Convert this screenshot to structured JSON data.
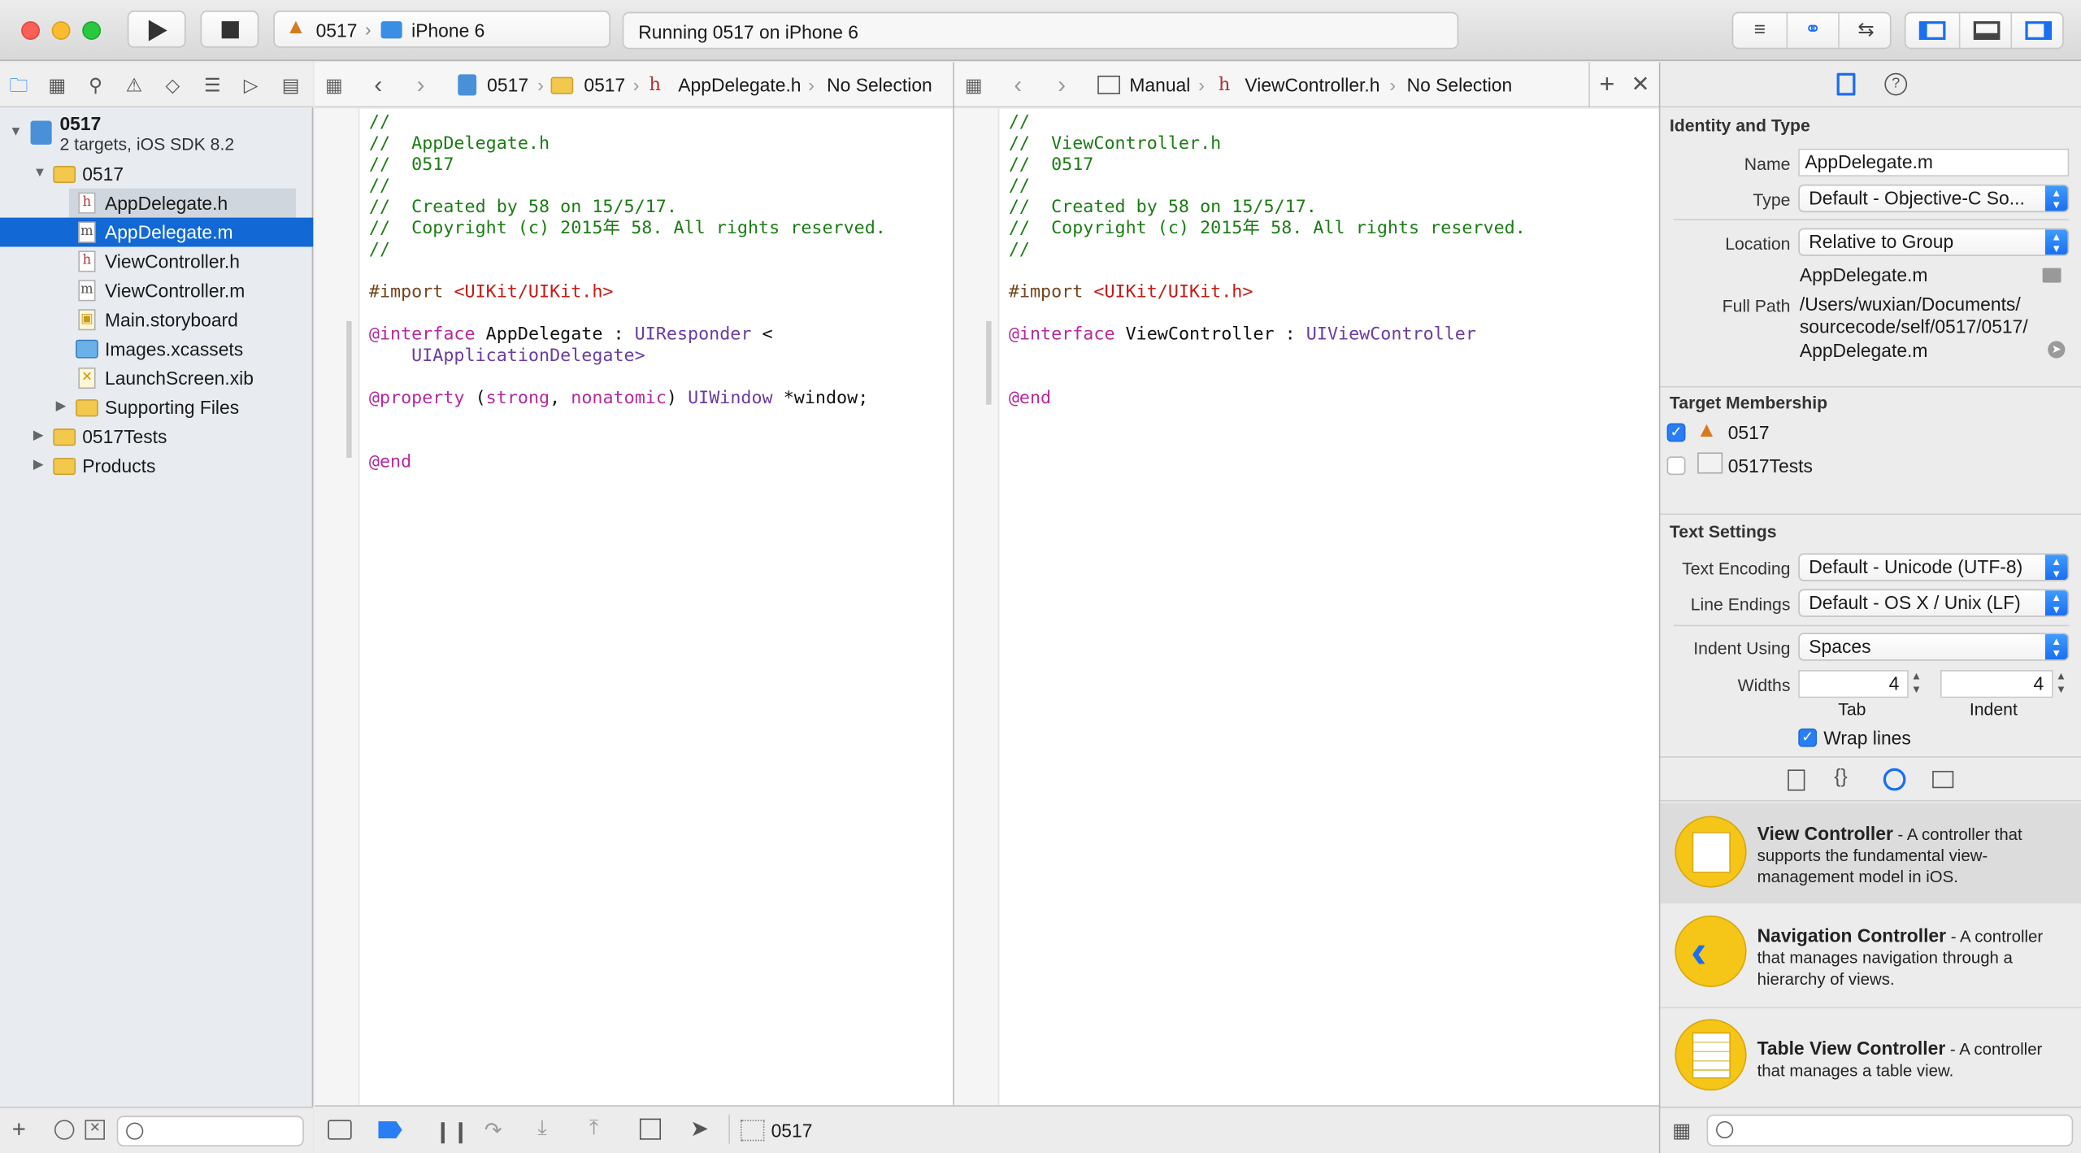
{
  "toolbar": {
    "scheme_target": "0517",
    "scheme_device": "iPhone 6",
    "activity": "Running 0517 on iPhone 6"
  },
  "navigator": {
    "project_name": "0517",
    "project_subtitle": "2 targets, iOS SDK 8.2",
    "items": [
      {
        "label": "0517",
        "kind": "folder"
      },
      {
        "label": "AppDelegate.h",
        "kind": "h"
      },
      {
        "label": "AppDelegate.m",
        "kind": "m"
      },
      {
        "label": "ViewController.h",
        "kind": "h"
      },
      {
        "label": "ViewController.m",
        "kind": "m"
      },
      {
        "label": "Main.storyboard",
        "kind": "storyboard"
      },
      {
        "label": "Images.xcassets",
        "kind": "xcassets"
      },
      {
        "label": "LaunchScreen.xib",
        "kind": "xib"
      },
      {
        "label": "Supporting Files",
        "kind": "folder"
      },
      {
        "label": "0517Tests",
        "kind": "folder"
      },
      {
        "label": "Products",
        "kind": "folder"
      }
    ]
  },
  "left_editor": {
    "jump": [
      "0517",
      "0517",
      "AppDelegate.h",
      "No Selection"
    ],
    "lines": [
      "//",
      "//  AppDelegate.h",
      "//  0517",
      "//",
      "//  Created by 58 on 15/5/17.",
      "//  Copyright (c) 2015年 58. All rights reserved.",
      "//",
      "#import <UIKit/UIKit.h>",
      "@interface AppDelegate : UIResponder <",
      "    UIApplicationDelegate>",
      "@property (strong, nonatomic) UIWindow *window;",
      "@end"
    ]
  },
  "right_editor": {
    "jump": [
      "Manual",
      "ViewController.h",
      "No Selection"
    ],
    "lines": [
      "//",
      "//  ViewController.h",
      "//  0517",
      "//",
      "//  Created by 58 on 15/5/17.",
      "//  Copyright (c) 2015年 58. All rights reserved.",
      "//",
      "#import <UIKit/UIKit.h>",
      "@interface ViewController : UIViewController",
      "@end"
    ]
  },
  "debug_bar": {
    "target": "0517"
  },
  "inspector": {
    "identity_header": "Identity and Type",
    "name_label": "Name",
    "name_value": "AppDelegate.m",
    "type_label": "Type",
    "type_value": "Default - Objective-C So...",
    "location_label": "Location",
    "location_value": "Relative to Group",
    "location_file": "AppDelegate.m",
    "fullpath_label": "Full Path",
    "fullpath_lines": [
      "/Users/wuxian/Documents/",
      "sourcecode/self/0517/0517/",
      "AppDelegate.m"
    ],
    "membership_header": "Target Membership",
    "targets": [
      {
        "name": "0517",
        "checked": true
      },
      {
        "name": "0517Tests",
        "checked": false
      }
    ],
    "text_settings_header": "Text Settings",
    "encoding_label": "Text Encoding",
    "encoding_value": "Default - Unicode (UTF-8)",
    "line_endings_label": "Line Endings",
    "line_endings_value": "Default - OS X / Unix (LF)",
    "indent_using_label": "Indent Using",
    "indent_using_value": "Spaces",
    "widths_label": "Widths",
    "tab_width": "4",
    "indent_width": "4",
    "tab_label": "Tab",
    "indent_label": "Indent",
    "wrap_lines_label": "Wrap lines"
  },
  "library": [
    {
      "title": "View Controller",
      "desc": " - A controller that supports the fundamental view-management model in iOS."
    },
    {
      "title": "Navigation Controller",
      "desc": " - A controller that manages navigation through a hierarchy of views."
    },
    {
      "title": "Table View Controller",
      "desc": " - A controller that manages a table view."
    }
  ]
}
